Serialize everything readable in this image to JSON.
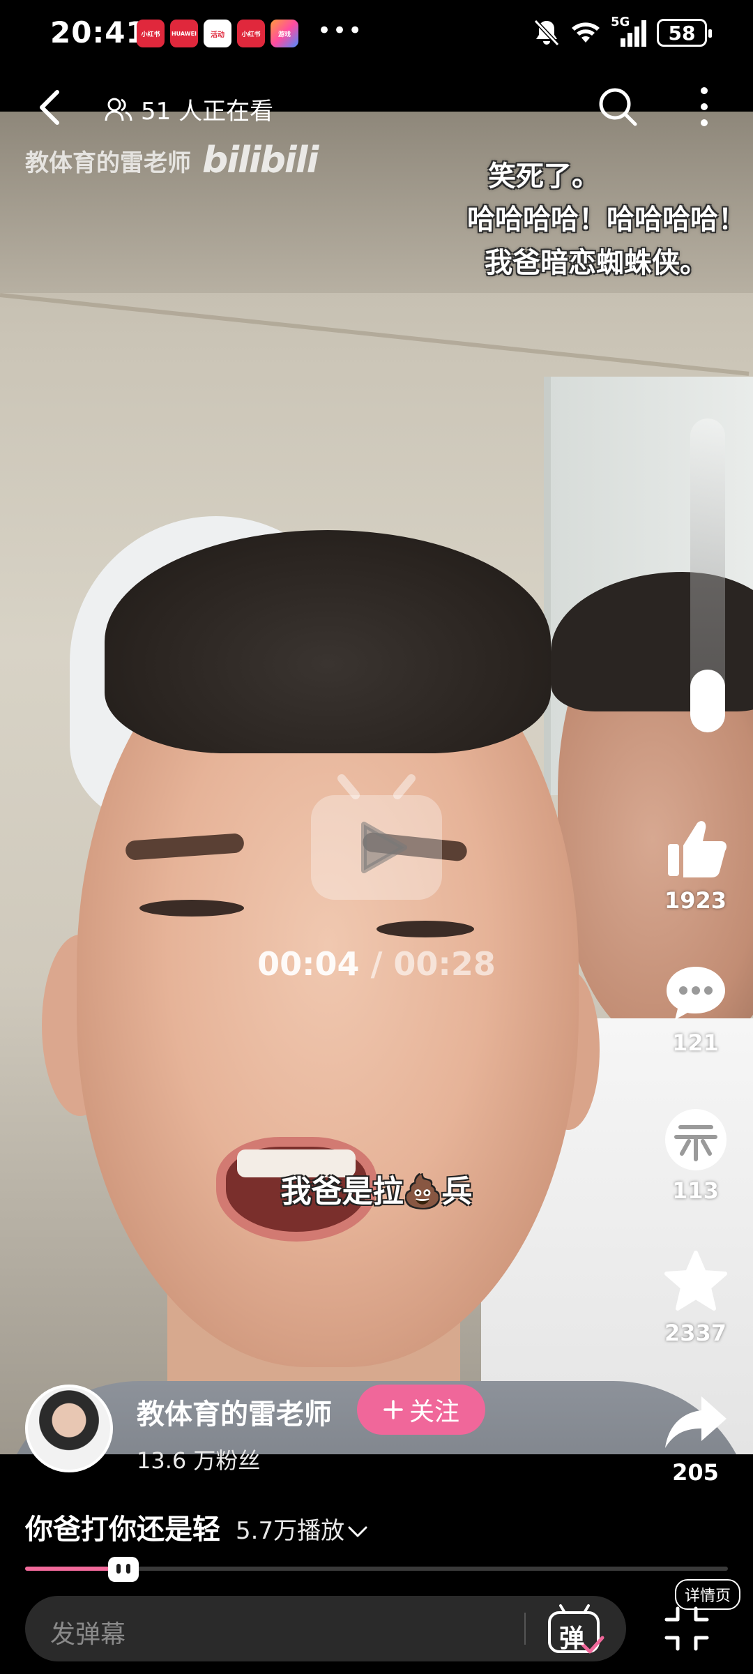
{
  "status_bar": {
    "time": "20:41",
    "notification_apps": [
      "小红书",
      "HUAWEI",
      "活动",
      "小红书",
      "游戏"
    ],
    "network": "5G",
    "battery": "58"
  },
  "top_nav": {
    "viewers": "51 人正在看"
  },
  "watermark": {
    "channel": "教体育的雷老师",
    "logo": "bilibili"
  },
  "overlay_text": {
    "line1": "笑死了。",
    "line2": "哈哈哈哈！哈哈哈哈！",
    "line3": "我爸暗恋蜘蛛侠。"
  },
  "subtitle": "我爸是拉💩兵",
  "player": {
    "current_time": "00:04",
    "separator": "/",
    "total_time": "00:28",
    "volume_level": 0.2,
    "progress": 0.14
  },
  "actions": {
    "like_count": "1923",
    "comment_count": "121",
    "coin_count": "113",
    "favorite_count": "2337",
    "share_count": "205"
  },
  "author": {
    "name": "教体育的雷老师",
    "follow_label": "关注",
    "fans": "13.6 万粉丝"
  },
  "video": {
    "title": "你爸打你还是轻",
    "plays": "5.7万播放"
  },
  "bottom_bar": {
    "detail_link": "详情页",
    "danmaku_placeholder": "发弹幕",
    "danmaku_toggle": "弹"
  },
  "colors": {
    "accent": "#f0679a",
    "progress": "#f26a9b"
  }
}
